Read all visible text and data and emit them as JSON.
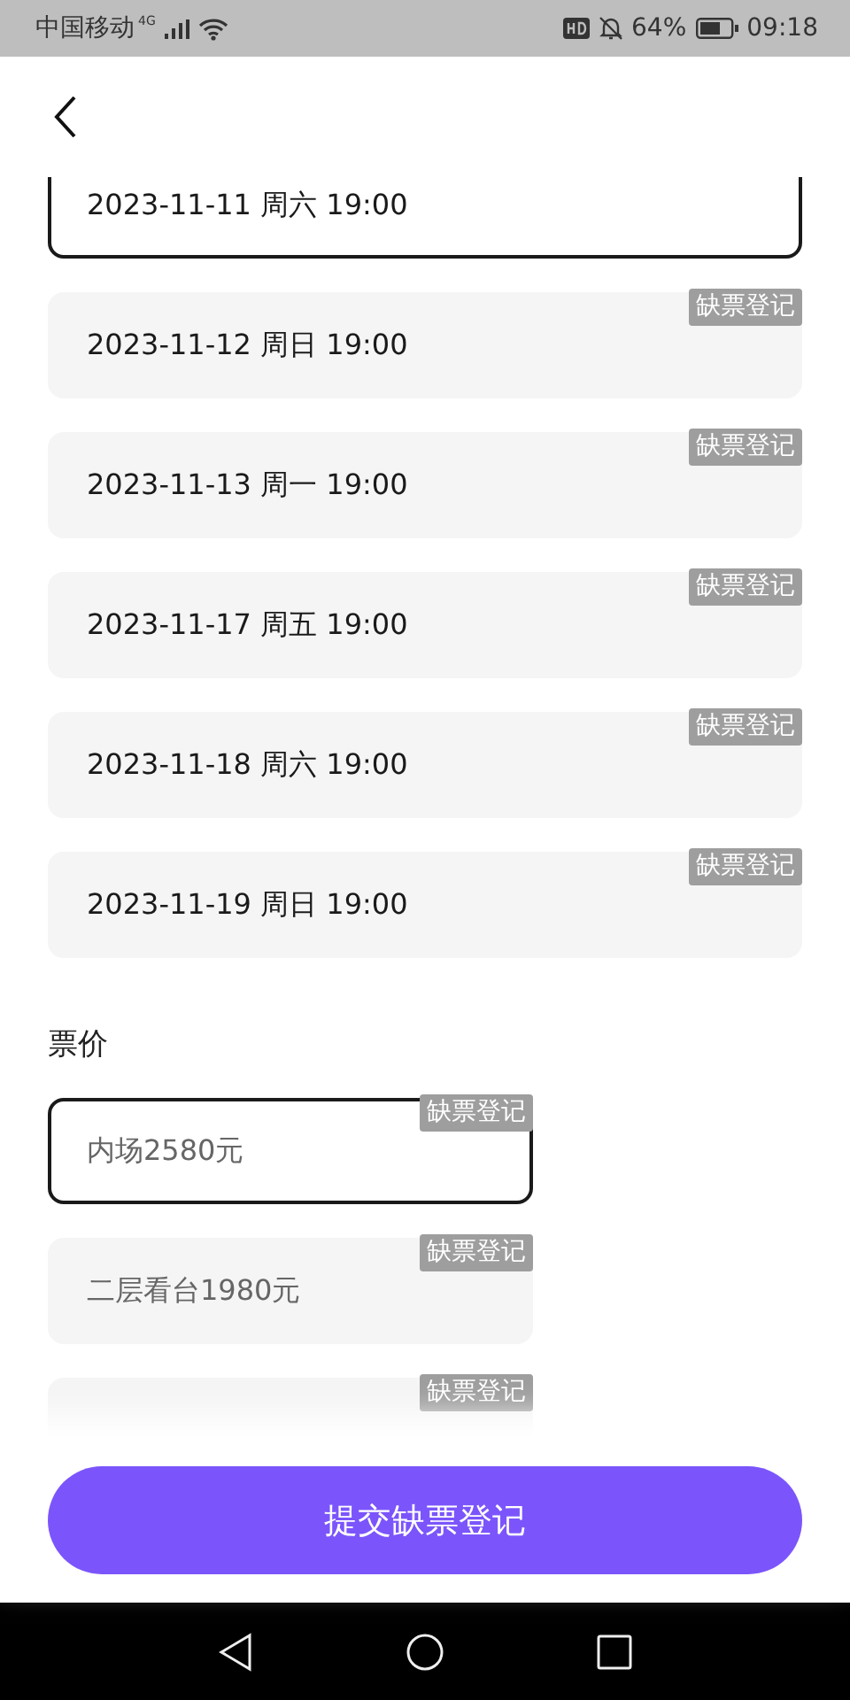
{
  "status_bar": {
    "carrier": "中国移动",
    "network": "4G",
    "battery": "64%",
    "time": "09:18"
  },
  "dates": [
    {
      "label": "2023-11-11 周六 19:00",
      "selected": true
    },
    {
      "label": "2023-11-12 周日 19:00",
      "selected": false,
      "badge": "缺票登记"
    },
    {
      "label": "2023-11-13 周一 19:00",
      "selected": false,
      "badge": "缺票登记"
    },
    {
      "label": "2023-11-17 周五 19:00",
      "selected": false,
      "badge": "缺票登记"
    },
    {
      "label": "2023-11-18 周六 19:00",
      "selected": false,
      "badge": "缺票登记"
    },
    {
      "label": "2023-11-19 周日 19:00",
      "selected": false,
      "badge": "缺票登记"
    }
  ],
  "price_section": {
    "title": "票价"
  },
  "prices": [
    {
      "label": "内场2580元",
      "selected": true,
      "badge": "缺票登记"
    },
    {
      "label": "二层看台1980元",
      "selected": false,
      "badge": "缺票登记"
    },
    {
      "selected": false,
      "badge": "缺票登记"
    }
  ],
  "submit_button": "提交缺票登记"
}
